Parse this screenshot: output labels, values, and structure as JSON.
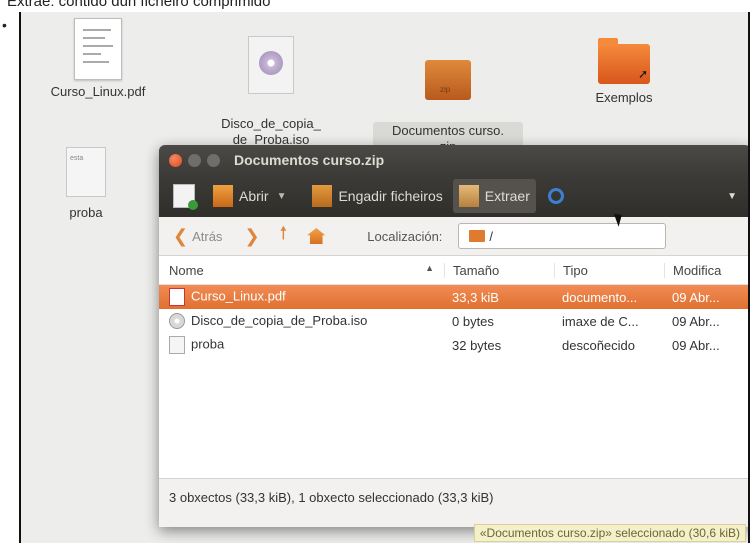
{
  "caption": "Extrae: contido dun ficheiro comprimido",
  "desktop": {
    "icons": [
      {
        "label": "Curso_Linux.pdf"
      },
      {
        "label": "Disco_de_copia_\nde_Proba.iso"
      },
      {
        "label": "Documentos curso.\nzip"
      },
      {
        "label": "Exemplos"
      },
      {
        "label": "proba",
        "thumb": "esta"
      }
    ],
    "status": "«Documentos curso.zip» seleccionado  (30,6 kiB)"
  },
  "window": {
    "title": "Documentos curso.zip",
    "toolbar": {
      "open": "Abrir",
      "add": "Engadir ficheiros",
      "extract": "Extraer"
    },
    "location": {
      "back": "Atrás",
      "label": "Localización:",
      "path": "/"
    },
    "columns": [
      "Nome",
      "Tamaño",
      "Tipo",
      "Modifica"
    ],
    "rows": [
      {
        "name": "Curso_Linux.pdf",
        "size": "33,3 kiB",
        "type": "documento...",
        "modified": "09 Abr..."
      },
      {
        "name": "Disco_de_copia_de_Proba.iso",
        "size": "0 bytes",
        "type": "imaxe de C...",
        "modified": "09 Abr..."
      },
      {
        "name": "proba",
        "size": "32 bytes",
        "type": "descoñecido",
        "modified": "09 Abr..."
      }
    ],
    "status": "3 obxectos (33,3 kiB), 1 obxecto seleccionado (33,3 kiB)"
  }
}
